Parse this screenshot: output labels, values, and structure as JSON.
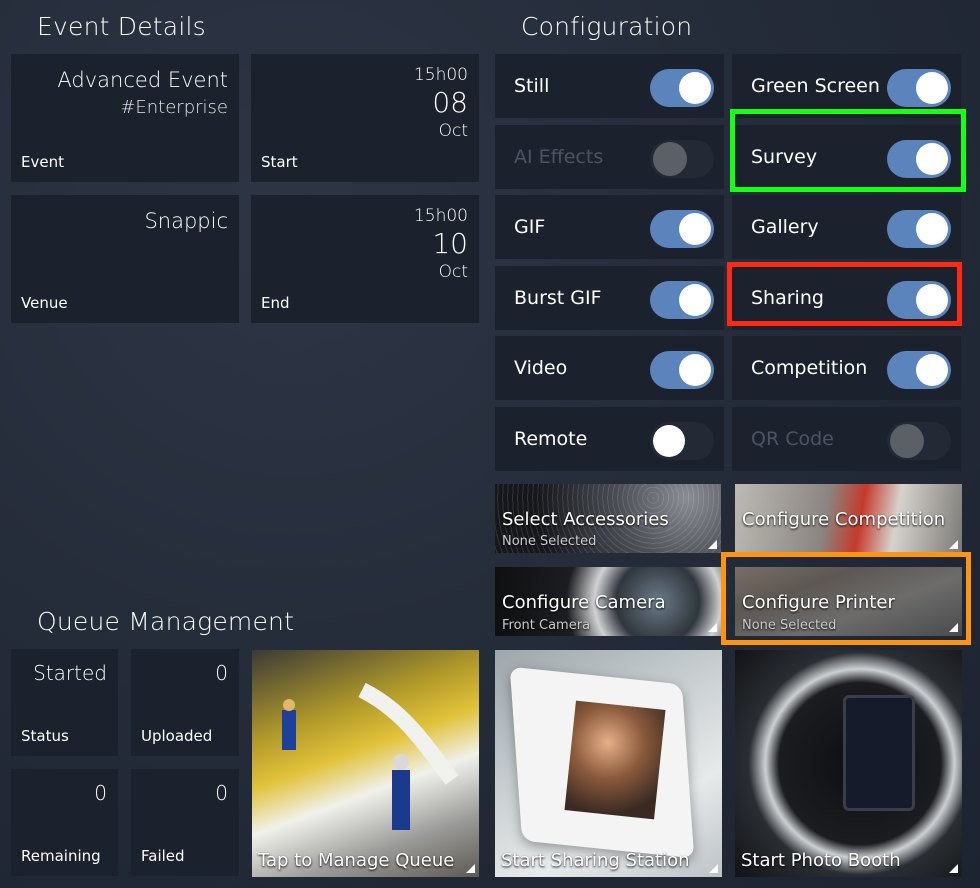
{
  "event_details": {
    "title": "Event Details",
    "event": {
      "name": "Advanced Event",
      "tag": "#Enterprise",
      "label": "Event"
    },
    "start": {
      "time": "15h00",
      "day": "08",
      "month": "Oct",
      "label": "Start"
    },
    "venue": {
      "name": "Snappic",
      "label": "Venue"
    },
    "end": {
      "time": "15h00",
      "day": "10",
      "month": "Oct",
      "label": "End"
    }
  },
  "configuration": {
    "title": "Configuration",
    "toggles": [
      {
        "label": "Still",
        "state": "on"
      },
      {
        "label": "Green Screen",
        "state": "on"
      },
      {
        "label": "AI Effects",
        "state": "disabled"
      },
      {
        "label": "Survey",
        "state": "on"
      },
      {
        "label": "GIF",
        "state": "on"
      },
      {
        "label": "Gallery",
        "state": "on"
      },
      {
        "label": "Burst GIF",
        "state": "on"
      },
      {
        "label": "Sharing",
        "state": "on"
      },
      {
        "label": "Video",
        "state": "on"
      },
      {
        "label": "Competition",
        "state": "on"
      },
      {
        "label": "Remote",
        "state": "off"
      },
      {
        "label": "QR Code",
        "state": "disabled"
      }
    ],
    "accessories": {
      "title": "Select Accessories",
      "subtitle": "None Selected"
    },
    "competition": {
      "title": "Configure Competition"
    },
    "camera": {
      "title": "Configure Camera",
      "subtitle": "Front Camera"
    },
    "printer": {
      "title": "Configure Printer",
      "subtitle": "None Selected"
    }
  },
  "queue": {
    "title": "Queue Management",
    "status": {
      "value": "Started",
      "label": "Status"
    },
    "uploaded": {
      "value": "0",
      "label": "Uploaded"
    },
    "remaining": {
      "value": "0",
      "label": "Remaining"
    },
    "failed": {
      "value": "0",
      "label": "Failed"
    },
    "manage": {
      "title": "Tap to Manage Queue"
    }
  },
  "actions": {
    "sharing_station": "Start Sharing Station",
    "photo_booth": "Start Photo Booth"
  },
  "colors": {
    "toggle_on": "#5b84bd",
    "highlight_survey": "#16ff16",
    "highlight_sharing": "#ff2a14",
    "highlight_printer": "#ff9410"
  }
}
